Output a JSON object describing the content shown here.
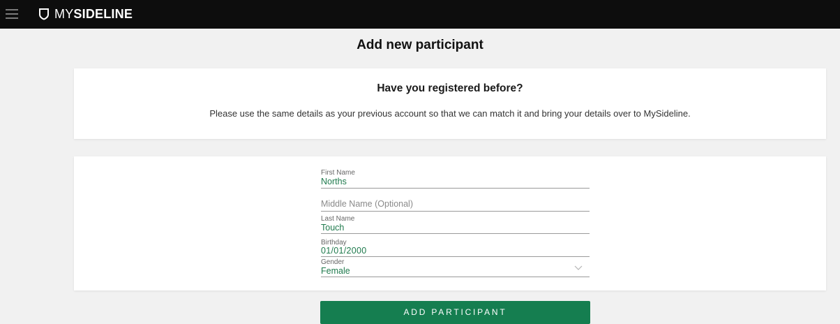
{
  "header": {
    "brand_prefix": "MY",
    "brand_suffix": "SIDELINE",
    "menu_icon": "hamburger-menu-icon",
    "logo_icon": "shield-icon"
  },
  "page": {
    "title": "Add new participant"
  },
  "info_card": {
    "heading": "Have you registered before?",
    "text": "Please use the same details as your previous account so that we can match it and bring your details over to MySideline."
  },
  "form": {
    "first_name": {
      "label": "First Name",
      "value": "Norths"
    },
    "middle_name": {
      "placeholder": "Middle Name (Optional)"
    },
    "last_name": {
      "label": "Last Name",
      "value": "Touch"
    },
    "birthday": {
      "label": "Birthday",
      "value": "01/01/2000"
    },
    "gender": {
      "label": "Gender",
      "value": "Female",
      "icon": "chevron-down-icon"
    }
  },
  "actions": {
    "submit_label": "ADD PARTICIPANT"
  },
  "colors": {
    "header_bg": "#0d0d0d",
    "page_bg": "#f1f1f1",
    "accent": "#157e50",
    "value_text": "#1f7a4d"
  }
}
